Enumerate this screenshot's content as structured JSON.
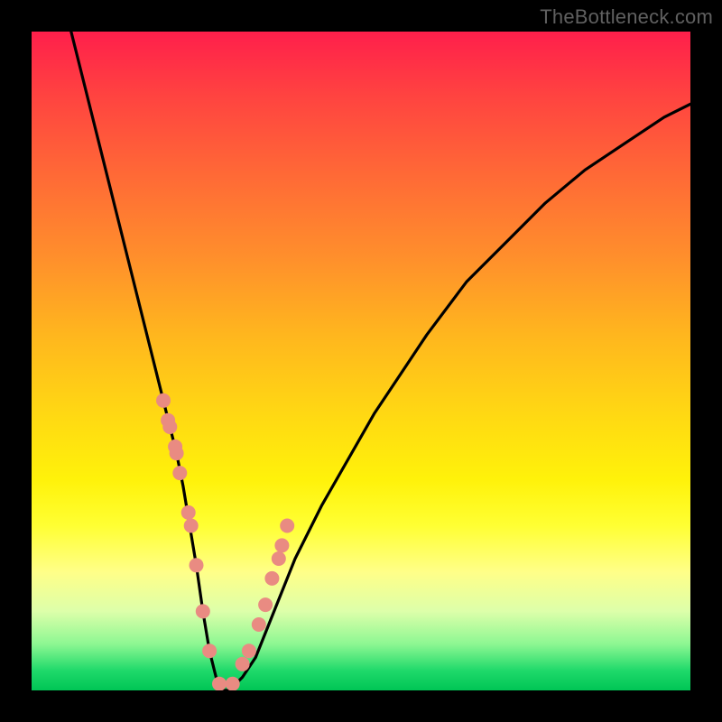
{
  "watermark": "TheBottleneck.com",
  "colors": {
    "outer_frame": "#000000",
    "curve_stroke": "#000000",
    "marker_fill": "#e98b82",
    "gradient_top": "#ff1f4b",
    "gradient_bottom": "#00c555"
  },
  "chart_data": {
    "type": "line",
    "title": "",
    "xlabel": "",
    "ylabel": "",
    "xlim": [
      0,
      100
    ],
    "ylim": [
      0,
      100
    ],
    "grid": false,
    "legend": false,
    "series": [
      {
        "name": "bottleneck-curve",
        "x": [
          6,
          8,
          10,
          12,
          14,
          16,
          18,
          20,
          21,
          22,
          23,
          24,
          25,
          26,
          27,
          28,
          29,
          30,
          32,
          34,
          36,
          38,
          40,
          44,
          48,
          52,
          56,
          60,
          66,
          72,
          78,
          84,
          90,
          96,
          100
        ],
        "values": [
          100,
          92,
          84,
          76,
          68,
          60,
          52,
          44,
          40,
          36,
          31,
          25,
          19,
          12,
          6,
          2,
          0,
          0,
          2,
          5,
          10,
          15,
          20,
          28,
          35,
          42,
          48,
          54,
          62,
          68,
          74,
          79,
          83,
          87,
          89
        ]
      }
    ],
    "markers": {
      "name": "highlighted-points",
      "x": [
        20.0,
        20.7,
        21.0,
        21.8,
        22.0,
        22.5,
        23.8,
        24.2,
        25.0,
        26.0,
        27.0,
        28.5,
        30.5,
        32.0,
        33.0,
        34.5,
        35.5,
        36.5,
        37.5,
        38.0,
        38.8
      ],
      "values": [
        44,
        41,
        40,
        37,
        36,
        33,
        27,
        25,
        19,
        12,
        6,
        1,
        1,
        4,
        6,
        10,
        13,
        17,
        20,
        22,
        25
      ]
    }
  }
}
